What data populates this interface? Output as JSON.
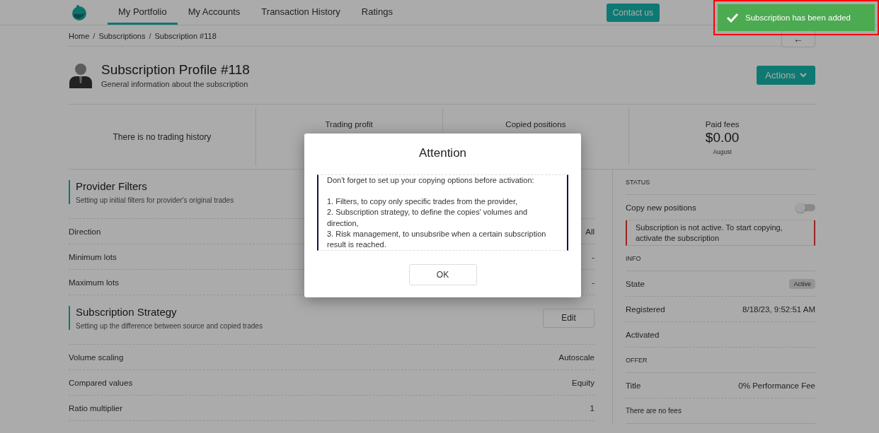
{
  "nav": {
    "tabs": [
      {
        "label": "My Portfolio",
        "selected": true
      },
      {
        "label": "My Accounts",
        "selected": false
      },
      {
        "label": "Transaction History",
        "selected": false
      },
      {
        "label": "Ratings",
        "selected": false
      }
    ],
    "contact_button": "Contact us"
  },
  "toast": {
    "message": "Subscription has been added"
  },
  "breadcrumb": [
    {
      "kind": "link",
      "text": "Home"
    },
    {
      "kind": "separator",
      "text": "/"
    },
    {
      "kind": "link",
      "text": "Subscriptions"
    },
    {
      "kind": "separator",
      "text": "/"
    },
    {
      "kind": "link",
      "text": "Subscription #118"
    }
  ],
  "back_button": "←",
  "profile": {
    "title": "Subscription Profile #118",
    "subtitle": "General information about the subscription"
  },
  "actions_button": "Actions",
  "stats": [
    {
      "kind": "message",
      "text": "There is no trading history"
    },
    {
      "kind": "metric",
      "label": "Trading profit"
    },
    {
      "kind": "metric",
      "label": "Copied positions"
    },
    {
      "kind": "metric",
      "label": "Paid fees",
      "value": "$0.00",
      "note": "August"
    }
  ],
  "sections": [
    {
      "title": "Provider Filters",
      "subtitle": "Setting up initial filters for provider's original trades",
      "rows": [
        {
          "label": "Direction",
          "value": "All"
        },
        {
          "label": "Minimum lots",
          "value": "-"
        },
        {
          "label": "Maximum lots",
          "value": "-"
        }
      ]
    },
    {
      "title": "Subscription Strategy",
      "subtitle": "Setting up the difference between source and copied trades",
      "button": "Edit",
      "rows": [
        {
          "label": "Volume scaling",
          "value": "Autoscale"
        },
        {
          "label": "Compared values",
          "value": "Equity"
        },
        {
          "label": "Ratio multiplier",
          "value": "1"
        }
      ]
    }
  ],
  "sidebar": [
    {
      "kind": "heading",
      "text": "STATUS"
    },
    {
      "kind": "toggle",
      "label": "Copy new positions",
      "on": false
    },
    {
      "kind": "alert",
      "text": "Subscription is not active. To start copying, activate the subscription"
    },
    {
      "kind": "heading",
      "text": "INFO"
    },
    {
      "kind": "badge",
      "label": "State",
      "value": "Active"
    },
    {
      "kind": "row",
      "label": "Registered",
      "value": "8/18/23, 9:52:51 AM"
    },
    {
      "kind": "row",
      "label": "Activated"
    },
    {
      "kind": "heading",
      "text": "OFFER"
    },
    {
      "kind": "row",
      "label": "Title",
      "value": "0% Performance Fee"
    },
    {
      "kind": "note",
      "text": "There are no fees"
    }
  ],
  "modal": {
    "title": "Attention",
    "intro": "Don't forget to set up your copying options before activation:",
    "items": [
      "1. Filters, to copy only specific trades from the provider,",
      "2. Subscription strategy, to define the copies' volumes and direction,",
      "3. Risk management, to unsubsribe when a certain subscription result is reached."
    ],
    "button": "OK"
  }
}
